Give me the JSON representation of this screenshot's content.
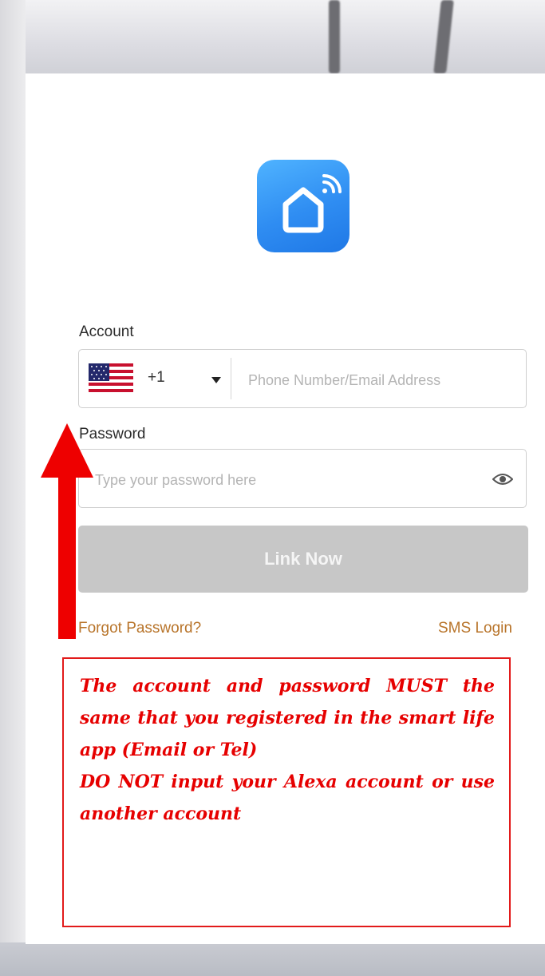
{
  "form": {
    "account_label": "Account",
    "country_code": "+1",
    "account_placeholder": "Phone Number/Email Address",
    "password_label": "Password",
    "password_placeholder": "Type your password here",
    "submit_label": "Link Now",
    "forgot_password_link": "Forgot Password?",
    "sms_login_link": "SMS Login"
  },
  "icons": {
    "app_logo": "smart-home-house-wifi-icon",
    "country_flag": "us-flag-icon",
    "dropdown": "caret-down-icon",
    "password_visibility": "eye-icon",
    "annotation_arrow": "red-up-arrow"
  },
  "notice": {
    "line1": "The account and password MUST the same that you registered in the smart life app (Email or Tel)",
    "line2": "DO NOT input your Alexa account or use another account"
  },
  "colors": {
    "logo_blue": "#2f8df2",
    "button_disabled": "#c7c7c7",
    "link_orange": "#b8742a",
    "annotation_red": "#e60000"
  }
}
